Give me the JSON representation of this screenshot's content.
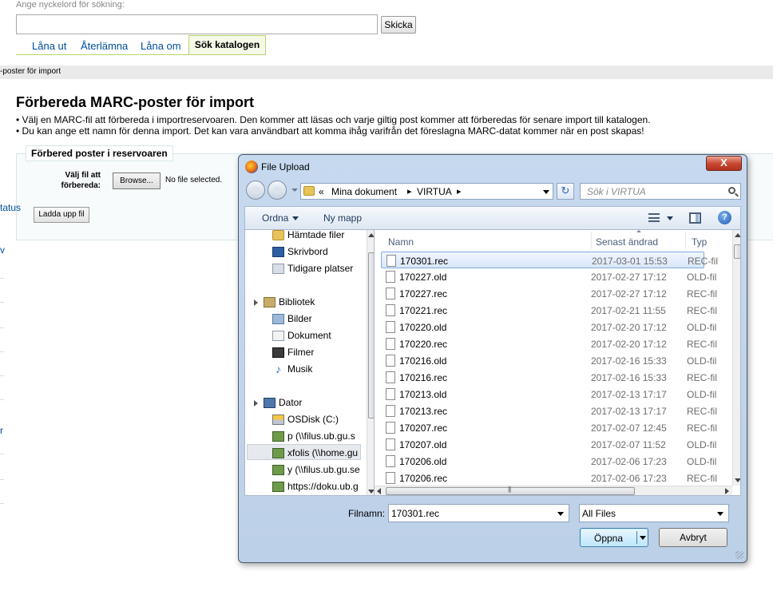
{
  "page": {
    "search_label": "Ange nyckelord för sökning:",
    "search_value": "",
    "search_button": "Skicka",
    "tabs": [
      "Låna ut",
      "Återlämna",
      "Låna om",
      "Sök katalogen"
    ],
    "breadcrumb": "-poster för import",
    "title": "Förbereda MARC-poster för import",
    "bullets": [
      "• Välj en MARC-fil att förbereda i importreservoaren. Den kommer att läsas och varje giltig post kommer att förberedas för senare import till katalogen.",
      "• Du kan ange ett namn för denna import. Det kan vara användbart att komma ihåg varifrån det föreslagna MARC-datat kommer när en post skapas!"
    ],
    "fieldset_legend": "Förbered poster i reservoaren",
    "file_label": "Välj fil att förbereda:",
    "browse_button": "Browse...",
    "no_file_text": "No file selected.",
    "upload_button": "Ladda upp fil",
    "side_fragments": [
      "tatus",
      "v",
      "r"
    ]
  },
  "dialog": {
    "title": "File Upload",
    "close_label": "X",
    "address": {
      "overflow": "«",
      "crumbs": [
        "Mina dokument",
        "VIRTUA"
      ],
      "separator": "▸"
    },
    "refresh_icon": "↻",
    "search_placeholder": "Sök i VIRTUA",
    "toolbar": {
      "organize": "Ordna",
      "new_folder": "Ny mapp",
      "help": "?"
    },
    "nav": [
      {
        "label": "Hämtade filer",
        "icon": "downloads-folder-icon"
      },
      {
        "label": "Skrivbord",
        "icon": "desktop-icon"
      },
      {
        "label": "Tidigare platser",
        "icon": "recent-places-icon"
      },
      {
        "label": "Bibliotek",
        "icon": "libraries-icon"
      },
      {
        "label": "Bilder",
        "icon": "pictures-icon"
      },
      {
        "label": "Dokument",
        "icon": "documents-icon"
      },
      {
        "label": "Filmer",
        "icon": "videos-icon"
      },
      {
        "label": "Musik",
        "icon": "music-icon"
      },
      {
        "label": "Dator",
        "icon": "computer-icon"
      },
      {
        "label": "OSDisk (C:)",
        "icon": "drive-icon"
      },
      {
        "label": "p (\\\\filus.ub.gu.s",
        "icon": "network-drive-icon"
      },
      {
        "label": "xfolis (\\\\home.gu",
        "icon": "network-drive-icon"
      },
      {
        "label": "y (\\\\filus.ub.gu.se",
        "icon": "network-drive-icon"
      },
      {
        "label": "https://doku.ub.g",
        "icon": "network-drive-icon"
      }
    ],
    "columns": {
      "name": "Namn",
      "date": "Senast ändrad",
      "type": "Typ"
    },
    "files": [
      {
        "name": "170301.rec",
        "date": "2017-03-01 15:53",
        "type": "REC-fil"
      },
      {
        "name": "170227.old",
        "date": "2017-02-27 17:12",
        "type": "OLD-fil"
      },
      {
        "name": "170227.rec",
        "date": "2017-02-27 17:12",
        "type": "REC-fil"
      },
      {
        "name": "170221.rec",
        "date": "2017-02-21 11:55",
        "type": "REC-fil"
      },
      {
        "name": "170220.old",
        "date": "2017-02-20 17:12",
        "type": "OLD-fil"
      },
      {
        "name": "170220.rec",
        "date": "2017-02-20 17:12",
        "type": "REC-fil"
      },
      {
        "name": "170216.old",
        "date": "2017-02-16 15:33",
        "type": "OLD-fil"
      },
      {
        "name": "170216.rec",
        "date": "2017-02-16 15:33",
        "type": "REC-fil"
      },
      {
        "name": "170213.old",
        "date": "2017-02-13 17:17",
        "type": "OLD-fil"
      },
      {
        "name": "170213.rec",
        "date": "2017-02-13 17:17",
        "type": "REC-fil"
      },
      {
        "name": "170207.rec",
        "date": "2017-02-07 12:45",
        "type": "REC-fil"
      },
      {
        "name": "170207.old",
        "date": "2017-02-07 11:52",
        "type": "OLD-fil"
      },
      {
        "name": "170206.old",
        "date": "2017-02-06 17:23",
        "type": "OLD-fil"
      },
      {
        "name": "170206.rec",
        "date": "2017-02-06 17:23",
        "type": "REC-fil"
      }
    ],
    "filename_label": "Filnamn:",
    "filename_value": "170301.rec",
    "filter_value": "All Files",
    "open_button": "Öppna",
    "cancel_button": "Avbryt"
  },
  "colors": {
    "link": "#004d99",
    "tab_border": "#b8d46c",
    "dialog_frame": "#c6d9ef",
    "close_red": "#c9452f",
    "selection": "#d8e7fb"
  }
}
